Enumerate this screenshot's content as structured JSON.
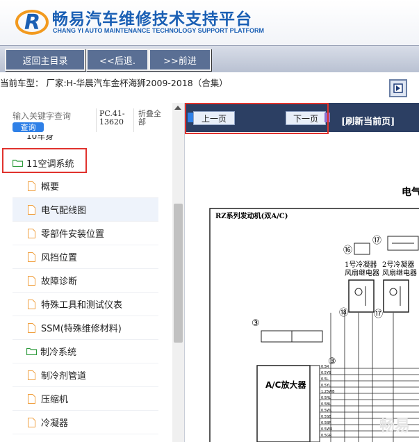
{
  "brand": {
    "title_cn": "畅易汽车维修技术支持平台",
    "title_en": "CHANG YI AUTO MAINTENANCE TECHNOLOGY SUPPORT PLATFORM",
    "logo_letter": "R"
  },
  "nav": {
    "home_label": "返回主目录",
    "back_label": "<<后退.",
    "forward_label": ">>前进"
  },
  "model": {
    "text": "当前车型： 厂家:H-华晨汽车金杯海狮2009-2018（合集）"
  },
  "search": {
    "placeholder": "输入关键字查询",
    "button_label": "查询",
    "code": "PC.41-13620",
    "collapse_label": "折叠全部"
  },
  "tree": {
    "partial_label": "10车身",
    "items": [
      {
        "label": "11空调系统",
        "type": "folder"
      },
      {
        "label": "概要",
        "type": "doc"
      },
      {
        "label": "电气配线图",
        "type": "doc"
      },
      {
        "label": "零部件安装位置",
        "type": "doc"
      },
      {
        "label": "风挡位置",
        "type": "doc"
      },
      {
        "label": "故障诊断",
        "type": "doc"
      },
      {
        "label": "特殊工具和测试仪表",
        "type": "doc"
      },
      {
        "label": "SSM(特殊维修材料)",
        "type": "doc"
      },
      {
        "label": "制冷系统",
        "type": "folder"
      },
      {
        "label": "制冷剂管道",
        "type": "doc"
      },
      {
        "label": "压缩机",
        "type": "doc"
      },
      {
        "label": "冷凝器",
        "type": "doc"
      }
    ]
  },
  "viewer": {
    "prev_label": "上一页",
    "next_label": "下一页",
    "refresh_label": "[刷新当前页]",
    "doc_heading": "电气",
    "diagram_title": "RZ系列发动机(双A/C)",
    "relay1_label": "1号冷凝器\n风扇继电器",
    "relay2_label": "2号冷凝器\n风扇继电器",
    "amp_label": "A/C放大器",
    "callouts": [
      "⑯",
      "⑰",
      "⑱",
      "⑰",
      "③",
      "③"
    ],
    "wire_labels": [
      "0.5R",
      "0.5YB",
      "0.5L",
      "0.5YL",
      "1.25WB",
      "0.5RL",
      "0.5BL",
      "0.5WL",
      "0.5SB",
      "0.5BR",
      "0.5WR",
      "0.5GR"
    ],
    "watermark": "畅易"
  },
  "colors": {
    "brand_blue": "#1a5fb4",
    "nav_button": "#5a6f94",
    "viewer_toolbar": "#2c3f63",
    "highlight_red": "#e0322d",
    "search_button": "#2f80e7",
    "folder_green": "#2e9b3c"
  }
}
